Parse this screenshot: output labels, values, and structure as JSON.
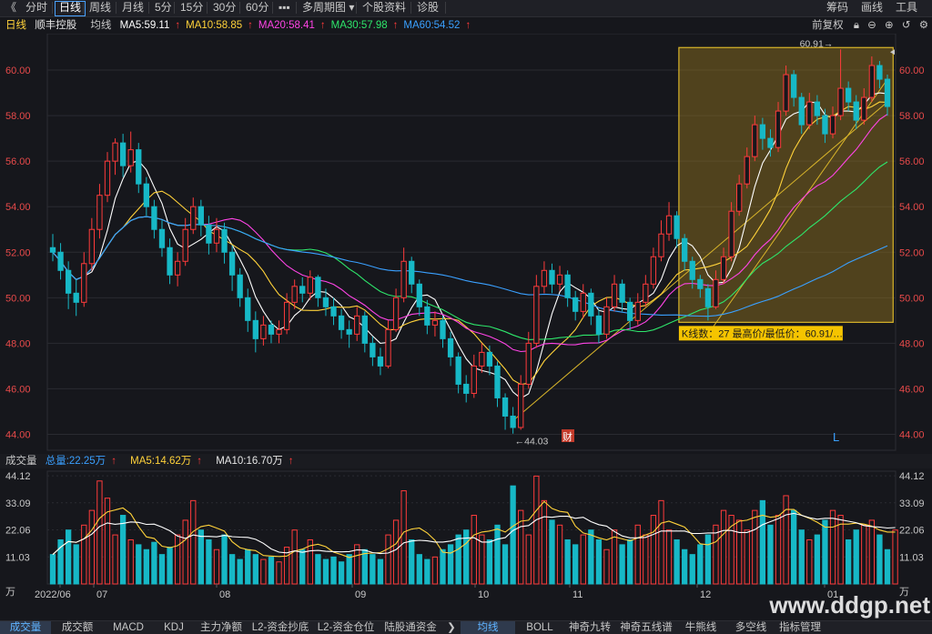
{
  "toolbar": {
    "back": "《",
    "left_items": [
      "分时",
      "日线",
      "周线",
      "月线",
      "5分",
      "15分",
      "30分",
      "60分",
      "▪▪▪",
      "多周期图",
      "个股资料",
      "诊股"
    ],
    "active": "日线",
    "right_items": [
      "筹码",
      "画线",
      "工具"
    ]
  },
  "header": {
    "period": "日线",
    "stock_name": "顺丰控股",
    "avg_label": "均线",
    "ma": [
      {
        "label": "MA5:59.11",
        "color": "#ffffff"
      },
      {
        "label": "MA10:58.85",
        "color": "#ffd23a"
      },
      {
        "label": "MA20:58.41",
        "color": "#ff44e6"
      },
      {
        "label": "MA30:57.98",
        "color": "#2ee66b"
      },
      {
        "label": "MA60:54.52",
        "color": "#3aa0ff"
      }
    ],
    "arrow": "↑",
    "restore": "前复权",
    "right_icons": [
      "lock-icon",
      "minus-icon",
      "plus-icon",
      "undo-icon",
      "gear-icon"
    ]
  },
  "colors": {
    "up": "#ff3b3b",
    "down": "#17b8c6",
    "axis": "#e84a4a",
    "grid": "#2a2b31"
  },
  "annotations": {
    "high_label": "60.91→",
    "low_label": "←44.03",
    "box_label": "K线数：27  最高价/最低价：60.91/…",
    "cai": "财",
    "L": "L"
  },
  "volume": {
    "title": "成交量",
    "total": "总量:22.25万",
    "ma5": "MA5:14.62万",
    "ma10": "MA10:16.70万",
    "arrow": "↑",
    "unit": "万",
    "ticks": [
      "44.12",
      "33.09",
      "22.06",
      "11.03"
    ]
  },
  "date_labels": [
    "2022/06",
    "07",
    "08",
    "09",
    "10",
    "11",
    "12",
    "01"
  ],
  "bottom_tabs": [
    "成交量",
    "成交额",
    "MACD",
    "KDJ",
    "主力净额",
    "L2-资金抄底",
    "L2-资金仓位",
    "陆股通资金",
    "均线",
    "BOLL",
    "神奇九转",
    "神奇五线谱",
    "牛熊线",
    "多空线",
    "指标管理"
  ],
  "bottom_active": [
    "成交量",
    "均线"
  ],
  "watermark": "www.ddgp.net",
  "chart_data": {
    "type": "candlestick",
    "price_axis": {
      "ticks": [
        60,
        58,
        56,
        54,
        52,
        50,
        48,
        46,
        44
      ],
      "labels": [
        "60.00",
        "58.00",
        "56.00",
        "54.00",
        "52.00",
        "50.00",
        "48.00",
        "46.00",
        "44.00"
      ],
      "range": [
        43.3,
        61.6
      ]
    },
    "high": 60.91,
    "low": 44.03,
    "candles": [
      [
        52.2,
        52.0,
        52.8,
        51.6
      ],
      [
        52.0,
        51.2,
        52.4,
        50.8
      ],
      [
        51.2,
        50.2,
        51.6,
        49.5
      ],
      [
        50.2,
        49.8,
        50.8,
        49.2
      ],
      [
        49.8,
        51.5,
        52.0,
        49.6
      ],
      [
        51.5,
        53.0,
        53.5,
        51.2
      ],
      [
        53.0,
        54.5,
        55.0,
        52.6
      ],
      [
        54.5,
        56.0,
        56.4,
        54.2
      ],
      [
        56.0,
        56.8,
        57.0,
        55.4
      ],
      [
        56.8,
        55.8,
        57.2,
        55.3
      ],
      [
        55.8,
        56.5,
        57.3,
        55.5
      ],
      [
        56.5,
        55.0,
        56.8,
        54.6
      ],
      [
        55.0,
        54.0,
        55.3,
        53.6
      ],
      [
        54.0,
        53.0,
        54.3,
        52.6
      ],
      [
        53.0,
        52.2,
        53.4,
        51.8
      ],
      [
        52.2,
        51.0,
        52.6,
        50.6
      ],
      [
        51.0,
        51.6,
        52.0,
        50.5
      ],
      [
        51.6,
        53.0,
        53.5,
        51.4
      ],
      [
        53.0,
        54.0,
        54.4,
        52.8
      ],
      [
        54.0,
        53.2,
        54.3,
        52.7
      ],
      [
        53.2,
        52.4,
        53.6,
        51.9
      ],
      [
        52.4,
        53.0,
        53.5,
        52.0
      ],
      [
        53.0,
        52.0,
        53.3,
        51.5
      ],
      [
        52.0,
        51.0,
        52.3,
        50.3
      ],
      [
        51.0,
        50.0,
        51.3,
        49.6
      ],
      [
        50.0,
        49.0,
        50.4,
        48.5
      ],
      [
        49.0,
        48.2,
        49.4,
        47.6
      ],
      [
        48.2,
        48.8,
        49.2,
        47.9
      ],
      [
        48.8,
        48.4,
        49.0,
        48.0
      ],
      [
        48.4,
        48.6,
        49.0,
        48.0
      ],
      [
        48.6,
        49.8,
        50.2,
        48.4
      ],
      [
        49.8,
        50.5,
        50.8,
        49.5
      ],
      [
        50.5,
        50.2,
        50.9,
        49.8
      ],
      [
        50.2,
        50.9,
        51.2,
        49.9
      ],
      [
        50.9,
        50.0,
        51.0,
        49.6
      ],
      [
        50.0,
        49.6,
        50.4,
        49.2
      ],
      [
        49.6,
        49.2,
        50.0,
        48.8
      ],
      [
        49.2,
        48.6,
        49.5,
        48.2
      ],
      [
        48.6,
        48.4,
        49.0,
        47.8
      ],
      [
        48.4,
        49.2,
        49.6,
        48.1
      ],
      [
        49.2,
        48.0,
        49.4,
        47.6
      ],
      [
        48.0,
        47.4,
        48.3,
        47.0
      ],
      [
        47.4,
        47.0,
        47.8,
        46.6
      ],
      [
        47.0,
        48.6,
        49.0,
        46.9
      ],
      [
        48.6,
        50.0,
        50.4,
        48.5
      ],
      [
        50.0,
        51.6,
        52.2,
        49.8
      ],
      [
        51.6,
        50.6,
        51.8,
        50.2
      ],
      [
        50.6,
        49.6,
        50.8,
        49.2
      ],
      [
        49.6,
        48.8,
        49.9,
        48.4
      ],
      [
        48.8,
        49.0,
        49.4,
        48.3
      ],
      [
        49.0,
        48.2,
        49.2,
        47.8
      ],
      [
        48.2,
        47.4,
        48.5,
        47.0
      ],
      [
        47.4,
        46.2,
        47.6,
        45.8
      ],
      [
        46.2,
        45.8,
        46.6,
        45.4
      ],
      [
        45.8,
        47.0,
        47.5,
        45.6
      ],
      [
        47.0,
        47.6,
        48.0,
        46.7
      ],
      [
        47.6,
        47.0,
        47.9,
        46.6
      ],
      [
        47.0,
        45.6,
        47.2,
        45.2
      ],
      [
        45.6,
        44.8,
        45.8,
        44.2
      ],
      [
        44.8,
        44.3,
        45.2,
        44.03
      ],
      [
        44.3,
        46.2,
        46.6,
        44.2
      ],
      [
        46.2,
        48.0,
        48.5,
        46.0
      ],
      [
        48.0,
        50.5,
        51.0,
        47.8
      ],
      [
        50.5,
        51.2,
        51.6,
        50.2
      ],
      [
        51.2,
        50.6,
        51.5,
        50.2
      ],
      [
        50.6,
        51.0,
        51.4,
        50.3
      ],
      [
        51.0,
        50.0,
        51.2,
        49.6
      ],
      [
        50.0,
        49.4,
        50.3,
        49.0
      ],
      [
        49.4,
        50.2,
        50.6,
        49.1
      ],
      [
        50.2,
        49.2,
        50.4,
        48.8
      ],
      [
        49.2,
        48.4,
        49.5,
        48.0
      ],
      [
        48.4,
        49.6,
        50.0,
        48.2
      ],
      [
        49.6,
        50.6,
        51.0,
        49.4
      ],
      [
        50.6,
        49.8,
        50.8,
        49.4
      ],
      [
        49.8,
        49.0,
        50.0,
        48.6
      ],
      [
        49.0,
        49.8,
        50.2,
        48.8
      ],
      [
        49.8,
        50.6,
        51.0,
        49.6
      ],
      [
        50.6,
        51.8,
        52.2,
        50.4
      ],
      [
        51.8,
        52.8,
        53.4,
        51.6
      ],
      [
        52.8,
        53.6,
        54.2,
        52.5
      ],
      [
        53.6,
        52.6,
        53.8,
        52.2
      ],
      [
        52.6,
        51.6,
        52.8,
        51.2
      ],
      [
        51.6,
        50.8,
        51.8,
        50.4
      ],
      [
        50.8,
        50.4,
        51.0,
        50.0
      ],
      [
        50.4,
        49.6,
        50.6,
        49.0
      ],
      [
        49.6,
        50.8,
        51.2,
        49.5
      ],
      [
        50.8,
        51.8,
        52.2,
        50.6
      ],
      [
        51.8,
        53.8,
        54.2,
        51.6
      ],
      [
        53.8,
        55.0,
        55.4,
        53.6
      ],
      [
        55.0,
        56.2,
        56.6,
        54.8
      ],
      [
        56.2,
        57.6,
        58.0,
        56.0
      ],
      [
        57.6,
        57.0,
        57.9,
        56.5
      ],
      [
        57.0,
        56.6,
        57.4,
        56.2
      ],
      [
        56.6,
        58.2,
        58.6,
        56.4
      ],
      [
        58.2,
        59.8,
        60.2,
        58.0
      ],
      [
        59.8,
        58.8,
        60.0,
        58.4
      ],
      [
        58.8,
        57.6,
        59.0,
        57.2
      ],
      [
        57.6,
        58.6,
        59.0,
        57.4
      ],
      [
        58.6,
        58.0,
        58.9,
        57.6
      ],
      [
        58.0,
        57.2,
        58.3,
        56.8
      ],
      [
        57.2,
        58.0,
        58.4,
        57.0
      ],
      [
        58.0,
        59.2,
        60.91,
        57.8
      ],
      [
        59.2,
        58.6,
        59.5,
        58.2
      ],
      [
        58.6,
        57.8,
        58.9,
        57.4
      ],
      [
        57.8,
        58.8,
        59.2,
        57.6
      ],
      [
        58.8,
        60.2,
        60.6,
        58.6
      ],
      [
        60.2,
        59.6,
        60.4,
        59.2
      ],
      [
        59.6,
        58.4,
        59.8,
        58.0
      ]
    ],
    "ma_values": {
      "MA5": 59.11,
      "MA10": 58.85,
      "MA20": 58.41,
      "MA30": 57.98,
      "MA60": 54.52
    },
    "volume_axis": {
      "ticks": [
        44.12,
        33.09,
        22.06,
        11.03
      ],
      "range": [
        0,
        46
      ]
    },
    "volume_unit": "万",
    "volumes": [
      12,
      18,
      22,
      16,
      24,
      30,
      42,
      35,
      20,
      28,
      18,
      16,
      14,
      17,
      12,
      15,
      20,
      26,
      34,
      22,
      18,
      14,
      20,
      12,
      10,
      14,
      12,
      10,
      11,
      9,
      15,
      22,
      14,
      18,
      12,
      10,
      11,
      9,
      12,
      16,
      14,
      12,
      10,
      20,
      26,
      38,
      18,
      12,
      10,
      11,
      14,
      16,
      20,
      22,
      28,
      20,
      18,
      24,
      16,
      40,
      30,
      20,
      44,
      34,
      26,
      24,
      18,
      16,
      20,
      22,
      18,
      14,
      22,
      16,
      18,
      24,
      20,
      28,
      34,
      22,
      18,
      14,
      12,
      16,
      20,
      24,
      30,
      28,
      26,
      22,
      30,
      34,
      24,
      28,
      36,
      30,
      22,
      18,
      20,
      26,
      30,
      28,
      18,
      22,
      24,
      26,
      20,
      14,
      22
    ]
  }
}
